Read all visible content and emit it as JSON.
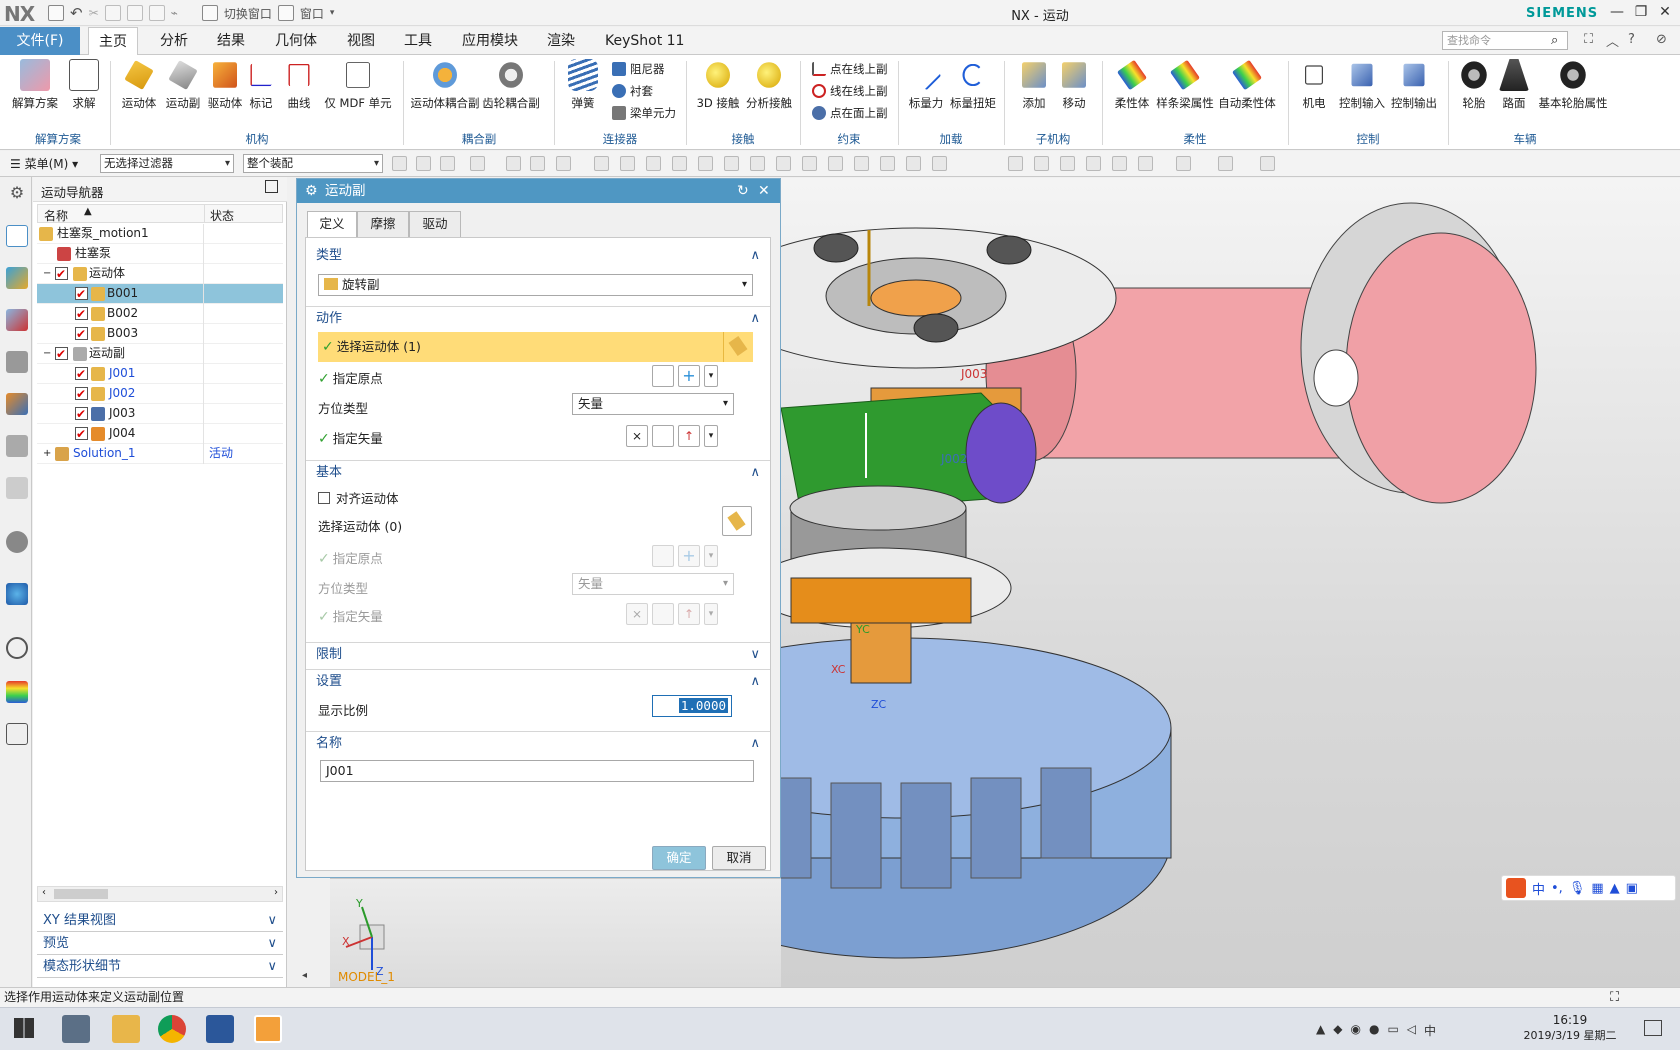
{
  "app": {
    "logo": "NX",
    "title": "NX - 运动",
    "brand": "SIEMENS",
    "quick_access": {
      "switch_window": "切换窗口",
      "window": "窗口"
    }
  },
  "menu": {
    "file": "文件(F)",
    "tabs": [
      "主页",
      "分析",
      "结果",
      "几何体",
      "视图",
      "工具",
      "应用模块",
      "渲染",
      "KeyShot 11"
    ],
    "active_tab": "主页",
    "search_placeholder": "查找命令"
  },
  "ribbon": {
    "buttons": {
      "solve_scheme": "解算方案",
      "solve": "求解",
      "body": "运动体",
      "joint": "运动副",
      "driver": "驱动体",
      "marker": "标记",
      "curve": "曲线",
      "mdf": "仅 MDF 单元",
      "coupler": "运动体耦合副",
      "gear": "齿轮耦合副",
      "spring": "弹簧",
      "damper": "阻尼器",
      "bushing": "衬套",
      "beam_force": "梁单元力",
      "contact3d": "3D 接触",
      "analysis_contact": "分析接触",
      "pt_on_line": "点在线上副",
      "line_on_line": "线在线上副",
      "pt_on_plane": "点在面上副",
      "scalar_force": "标量力",
      "scalar_torque": "标量扭矩",
      "add": "添加",
      "move": "移动",
      "flex_body": "柔性体",
      "spline_beam": "样条梁属性",
      "auto_flex": "自动柔性体",
      "motor": "机电",
      "ctrl_in": "控制输入",
      "ctrl_out": "控制输出",
      "tire": "轮胎",
      "road": "路面",
      "basic_tire": "基本轮胎属性"
    },
    "groups": [
      "解算方案",
      "机构",
      "耦合副",
      "连接器",
      "接触",
      "约束",
      "加载",
      "子机构",
      "柔性",
      "控制",
      "车辆"
    ]
  },
  "toolbar2": {
    "menu": "菜单(M)",
    "filter": "无选择过滤器",
    "assembly": "整个装配"
  },
  "navigator": {
    "title": "运动导航器",
    "col_name": "名称",
    "col_state": "状态",
    "tree": [
      {
        "label": "柱塞泵_motion1",
        "state": ""
      },
      {
        "label": "柱塞泵",
        "state": ""
      },
      {
        "label": "运动体",
        "state": ""
      },
      {
        "label": "B001",
        "state": ""
      },
      {
        "label": "B002",
        "state": ""
      },
      {
        "label": "B003",
        "state": ""
      },
      {
        "label": "运动副",
        "state": ""
      },
      {
        "label": "J001",
        "state": ""
      },
      {
        "label": "J002",
        "state": ""
      },
      {
        "label": "J003",
        "state": ""
      },
      {
        "label": "J004",
        "state": ""
      },
      {
        "label": "Solution_1",
        "state": "活动"
      }
    ],
    "bottom_sections": [
      "XY 结果视图",
      "预览",
      "模态形状细节"
    ]
  },
  "dialog": {
    "title": "运动副",
    "tabs": [
      "定义",
      "摩擦",
      "驱动"
    ],
    "type": {
      "header": "类型",
      "value": "旋转副"
    },
    "action": {
      "header": "动作",
      "select_body": "选择运动体 (1)",
      "origin": "指定原点",
      "orient_type_label": "方位类型",
      "orient_type_value": "矢量",
      "vector": "指定矢量"
    },
    "base": {
      "header": "基本",
      "align": "对齐运动体",
      "select_body": "选择运动体 (0)",
      "origin": "指定原点",
      "orient_type_label": "方位类型",
      "orient_type_value": "矢量",
      "vector": "指定矢量"
    },
    "limits": {
      "header": "限制"
    },
    "settings": {
      "header": "设置",
      "scale_label": "显示比例",
      "scale_value": "1.0000"
    },
    "name": {
      "header": "名称",
      "value": "J001"
    },
    "ok": "确定",
    "cancel": "取消"
  },
  "viewport": {
    "model_label": "MODEL_1",
    "axis_labels": {
      "xc": "XC",
      "yc": "YC",
      "zc": "ZC"
    },
    "joint_labels": [
      "J003",
      "J002"
    ],
    "triad": {
      "x": "X",
      "y": "Y",
      "z": "Z"
    },
    "ime": {
      "mode": "中"
    }
  },
  "statusbar": {
    "message": "选择作用运动体来定义运动副位置"
  },
  "taskbar": {
    "time": "16:19",
    "date": "2019/3/19 星期二"
  },
  "colors": {
    "accent": "#4b8fc6",
    "highlight": "#ffdc78",
    "selected_row": "#8ec4db",
    "siemens": "#009999"
  }
}
